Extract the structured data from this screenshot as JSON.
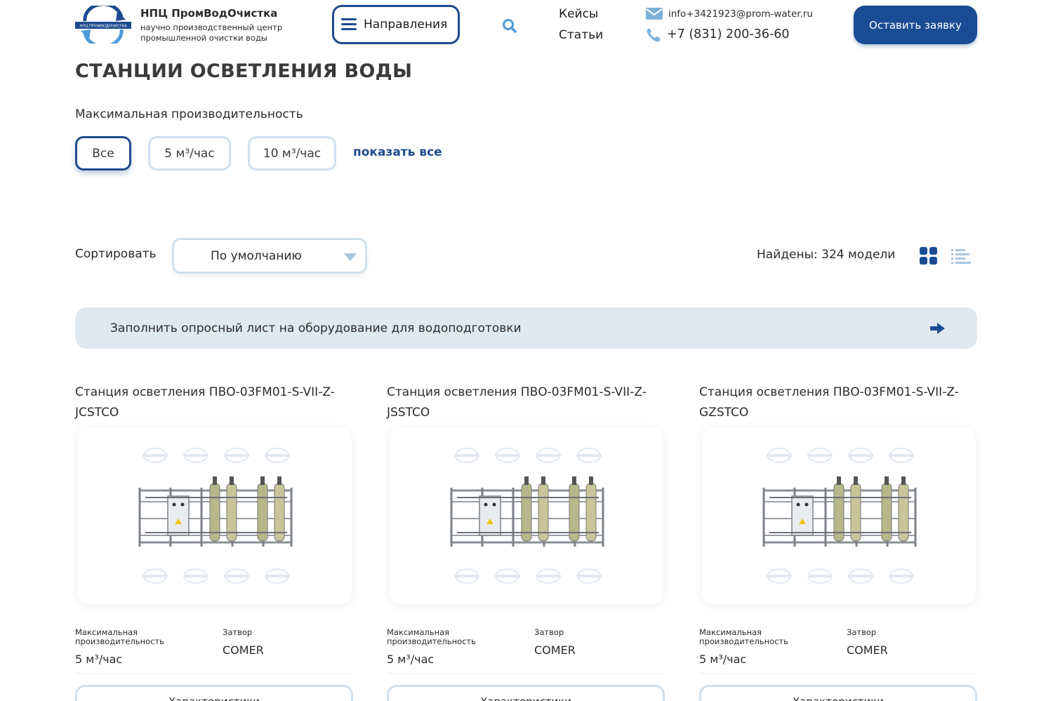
{
  "header": {
    "brand_name": "НПЦ ПромВодОчистка",
    "brand_subtitle": "научно производственный центр промышленной очистки воды",
    "logo_text": "НПЦ ПРОМВОДОЧИСТКА",
    "nav_button": "Направления",
    "links": {
      "cases": "Кейсы",
      "articles": "Статьи"
    },
    "email": "info+3421923@prom-water.ru",
    "phone": "+7 (831) 200-36-60",
    "cta": "Оставить заявку"
  },
  "page_title": "СТАНЦИИ ОСВЕТЛЕНИЯ ВОДЫ",
  "filter": {
    "label": "Максимальная производительность",
    "options": [
      "Все",
      "5 м³/час",
      "10 м³/час"
    ],
    "active": "Все",
    "show_all": "показать все"
  },
  "sort": {
    "label": "Сортировать",
    "selected": "По умолчанию"
  },
  "found": "Найдены: 324 модели",
  "banner": {
    "text": "Заполнить опросный лист на оборудование для водоподготовки"
  },
  "products": [
    {
      "title": "Станция осветления ПВО-03FM01-S-VII-Z-JCSTCO",
      "spec1_name": "Максимальная производительность",
      "spec1_value": "5 м³/час",
      "spec2_name": "Затвор",
      "spec2_value": "COMER",
      "button": "Характеристики"
    },
    {
      "title": "Станция осветления ПВО-03FM01-S-VII-Z-JSSTCO",
      "spec1_name": "Максимальная производительность",
      "spec1_value": "5 м³/час",
      "spec2_name": "Затвор",
      "spec2_value": "COMER",
      "button": "Характеристики"
    },
    {
      "title": "Станция осветления ПВО-03FM01-S-VII-Z-GZSTCO",
      "spec1_name": "Максимальная производительность",
      "spec1_value": "5 м³/час",
      "spec2_name": "Затвор",
      "spec2_value": "COMER",
      "button": "Характеристики"
    }
  ],
  "icons": {
    "nav": "menu-icon",
    "search": "search-icon",
    "email": "mail-icon",
    "phone": "phone-icon",
    "grid_view": "grid-view-icon",
    "list_view": "list-view-icon",
    "banner": "arrow-right-icon"
  },
  "colors": {
    "primary": "#1a4c94",
    "chip_border": "#cfe0ee",
    "banner_bg": "#e1e9f0",
    "accent_light": "#7fb0d8"
  }
}
